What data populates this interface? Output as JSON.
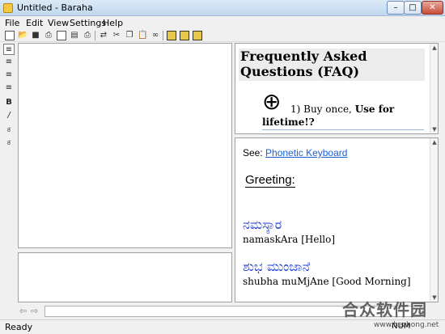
{
  "window": {
    "title": "Untitled - Baraha",
    "min": "–",
    "max": "□",
    "close": "✕"
  },
  "menu": [
    "File",
    "Edit",
    "View",
    "Settings",
    "Help"
  ],
  "toolbar_icons": [
    "new-icon",
    "open-icon",
    "save-icon",
    "print-setup-icon",
    "export-icon",
    "find-icon",
    "print-icon",
    "convert-icon",
    "cut-icon",
    "copy-icon",
    "paste-icon",
    "binoculars-icon",
    "view1-icon",
    "view2-icon",
    "view3-icon"
  ],
  "left_tools": {
    "align_left": "≡",
    "align_center": "≡",
    "align_right": "≡",
    "justify": "≡",
    "bold": "B",
    "italic": "/",
    "kn1": "ಕ",
    "kn2": "ಕ"
  },
  "faq": {
    "heading": "Frequently Asked Questions (FAQ)",
    "plus": "⊕",
    "item_number": "1) Buy once, ",
    "item_bold": "Use for",
    "item_line2": "lifetime!?"
  },
  "help": {
    "see_label": "See: ",
    "see_link": "Phonetic Keyboard",
    "greeting": "Greeting:",
    "entries": [
      {
        "kannada": "ನಮಸ್ಕಾರ",
        "translit": "namaskAra [Hello]"
      },
      {
        "kannada": "ಶುಭ ಮುಂಜಾನೆ",
        "translit": "shubha muMjAne [Good Morning]"
      }
    ]
  },
  "nav": {
    "back": "⇦",
    "forward": "⇨"
  },
  "status": {
    "ready": "Ready",
    "num": "NUM"
  },
  "watermark": {
    "brand": "合众软件园",
    "url": "www.hezhong.net"
  }
}
